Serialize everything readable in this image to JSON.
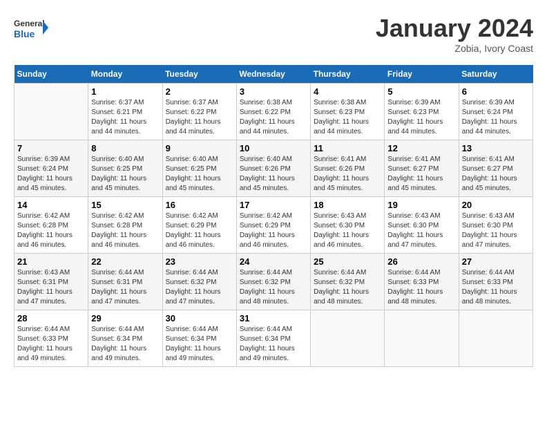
{
  "header": {
    "logo_line1": "General",
    "logo_line2": "Blue",
    "month": "January 2024",
    "location": "Zobia, Ivory Coast"
  },
  "weekdays": [
    "Sunday",
    "Monday",
    "Tuesday",
    "Wednesday",
    "Thursday",
    "Friday",
    "Saturday"
  ],
  "weeks": [
    [
      {
        "day": null
      },
      {
        "day": 1,
        "sunrise": "6:37 AM",
        "sunset": "6:21 PM",
        "daylight": "11 hours and 44 minutes."
      },
      {
        "day": 2,
        "sunrise": "6:37 AM",
        "sunset": "6:22 PM",
        "daylight": "11 hours and 44 minutes."
      },
      {
        "day": 3,
        "sunrise": "6:38 AM",
        "sunset": "6:22 PM",
        "daylight": "11 hours and 44 minutes."
      },
      {
        "day": 4,
        "sunrise": "6:38 AM",
        "sunset": "6:23 PM",
        "daylight": "11 hours and 44 minutes."
      },
      {
        "day": 5,
        "sunrise": "6:39 AM",
        "sunset": "6:23 PM",
        "daylight": "11 hours and 44 minutes."
      },
      {
        "day": 6,
        "sunrise": "6:39 AM",
        "sunset": "6:24 PM",
        "daylight": "11 hours and 44 minutes."
      }
    ],
    [
      {
        "day": 7,
        "sunrise": "6:39 AM",
        "sunset": "6:24 PM",
        "daylight": "11 hours and 45 minutes."
      },
      {
        "day": 8,
        "sunrise": "6:40 AM",
        "sunset": "6:25 PM",
        "daylight": "11 hours and 45 minutes."
      },
      {
        "day": 9,
        "sunrise": "6:40 AM",
        "sunset": "6:25 PM",
        "daylight": "11 hours and 45 minutes."
      },
      {
        "day": 10,
        "sunrise": "6:40 AM",
        "sunset": "6:26 PM",
        "daylight": "11 hours and 45 minutes."
      },
      {
        "day": 11,
        "sunrise": "6:41 AM",
        "sunset": "6:26 PM",
        "daylight": "11 hours and 45 minutes."
      },
      {
        "day": 12,
        "sunrise": "6:41 AM",
        "sunset": "6:27 PM",
        "daylight": "11 hours and 45 minutes."
      },
      {
        "day": 13,
        "sunrise": "6:41 AM",
        "sunset": "6:27 PM",
        "daylight": "11 hours and 45 minutes."
      }
    ],
    [
      {
        "day": 14,
        "sunrise": "6:42 AM",
        "sunset": "6:28 PM",
        "daylight": "11 hours and 46 minutes."
      },
      {
        "day": 15,
        "sunrise": "6:42 AM",
        "sunset": "6:28 PM",
        "daylight": "11 hours and 46 minutes."
      },
      {
        "day": 16,
        "sunrise": "6:42 AM",
        "sunset": "6:29 PM",
        "daylight": "11 hours and 46 minutes."
      },
      {
        "day": 17,
        "sunrise": "6:42 AM",
        "sunset": "6:29 PM",
        "daylight": "11 hours and 46 minutes."
      },
      {
        "day": 18,
        "sunrise": "6:43 AM",
        "sunset": "6:30 PM",
        "daylight": "11 hours and 46 minutes."
      },
      {
        "day": 19,
        "sunrise": "6:43 AM",
        "sunset": "6:30 PM",
        "daylight": "11 hours and 47 minutes."
      },
      {
        "day": 20,
        "sunrise": "6:43 AM",
        "sunset": "6:30 PM",
        "daylight": "11 hours and 47 minutes."
      }
    ],
    [
      {
        "day": 21,
        "sunrise": "6:43 AM",
        "sunset": "6:31 PM",
        "daylight": "11 hours and 47 minutes."
      },
      {
        "day": 22,
        "sunrise": "6:44 AM",
        "sunset": "6:31 PM",
        "daylight": "11 hours and 47 minutes."
      },
      {
        "day": 23,
        "sunrise": "6:44 AM",
        "sunset": "6:32 PM",
        "daylight": "11 hours and 47 minutes."
      },
      {
        "day": 24,
        "sunrise": "6:44 AM",
        "sunset": "6:32 PM",
        "daylight": "11 hours and 48 minutes."
      },
      {
        "day": 25,
        "sunrise": "6:44 AM",
        "sunset": "6:32 PM",
        "daylight": "11 hours and 48 minutes."
      },
      {
        "day": 26,
        "sunrise": "6:44 AM",
        "sunset": "6:33 PM",
        "daylight": "11 hours and 48 minutes."
      },
      {
        "day": 27,
        "sunrise": "6:44 AM",
        "sunset": "6:33 PM",
        "daylight": "11 hours and 48 minutes."
      }
    ],
    [
      {
        "day": 28,
        "sunrise": "6:44 AM",
        "sunset": "6:33 PM",
        "daylight": "11 hours and 49 minutes."
      },
      {
        "day": 29,
        "sunrise": "6:44 AM",
        "sunset": "6:34 PM",
        "daylight": "11 hours and 49 minutes."
      },
      {
        "day": 30,
        "sunrise": "6:44 AM",
        "sunset": "6:34 PM",
        "daylight": "11 hours and 49 minutes."
      },
      {
        "day": 31,
        "sunrise": "6:44 AM",
        "sunset": "6:34 PM",
        "daylight": "11 hours and 49 minutes."
      },
      {
        "day": null
      },
      {
        "day": null
      },
      {
        "day": null
      }
    ]
  ],
  "labels": {
    "sunrise": "Sunrise:",
    "sunset": "Sunset:",
    "daylight": "Daylight:"
  }
}
